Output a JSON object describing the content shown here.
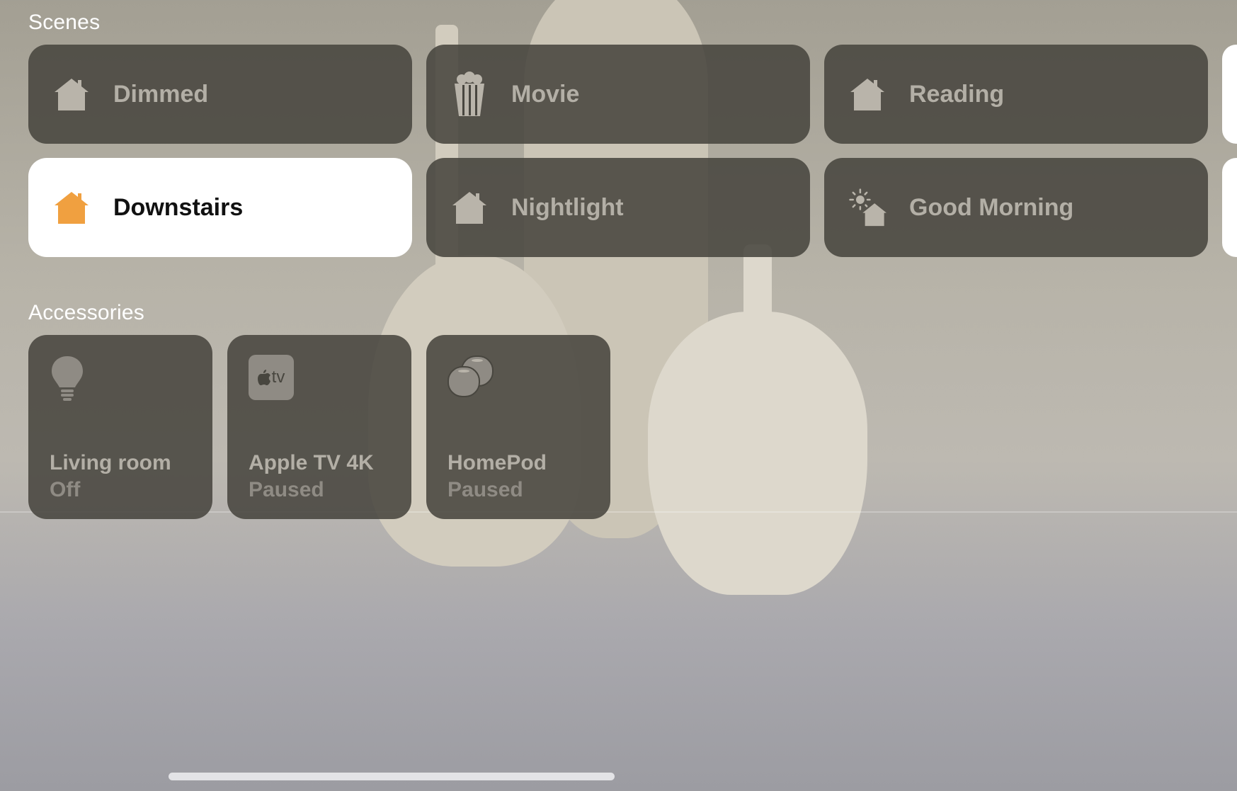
{
  "sections": {
    "scenes_title": "Scenes",
    "accessories_title": "Accessories"
  },
  "scenes": [
    {
      "label": "Dimmed",
      "icon": "house-icon",
      "active": false
    },
    {
      "label": "Movie",
      "icon": "popcorn-icon",
      "active": false
    },
    {
      "label": "Reading",
      "icon": "house-icon",
      "active": false
    },
    {
      "label": "Downstairs",
      "icon": "house-icon",
      "active": true,
      "icon_color": "#f0a040"
    },
    {
      "label": "Nightlight",
      "icon": "house-icon",
      "active": false
    },
    {
      "label": "Good Morning",
      "icon": "sunrise-house-icon",
      "active": false
    }
  ],
  "accessories": [
    {
      "name": "Living room",
      "status": "Off",
      "icon": "lightbulb-icon"
    },
    {
      "name": "Apple TV 4K",
      "status": "Paused",
      "icon": "apple-tv-icon",
      "icon_text": "tv"
    },
    {
      "name": "HomePod",
      "status": "Paused",
      "icon": "homepod-icon"
    }
  ],
  "colors": {
    "tile_inactive": "#48463f",
    "tile_active": "#ffffff",
    "active_icon": "#f0a040",
    "inactive_text": "#b3afa6"
  }
}
